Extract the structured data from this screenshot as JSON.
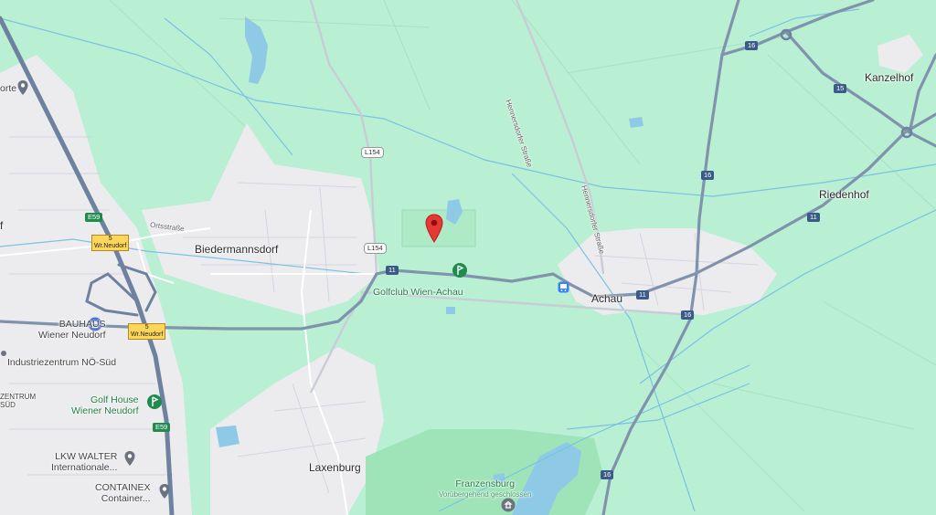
{
  "map": {
    "colors": {
      "land": "#b9efd2",
      "urban": "#ececef",
      "water": "#8ecae6",
      "motorway": "#7b8fa8",
      "park": "#9ee4b8",
      "marker": "#e53935"
    },
    "places": {
      "biedermannsdorf": "Biedermannsdorf",
      "achau": "Achau",
      "laxenburg": "Laxenburg",
      "kanzelhof": "Kanzelhof",
      "riedenhof": "Riedenhof"
    },
    "pois": {
      "golfclub": "Golfclub Wien-Achau",
      "bauhaus_1": "BAUHAUS",
      "bauhaus_2": "Wiener Neudorf",
      "industriezentrum": "Industriezentrum NÖ-Süd",
      "izentrum_cut_1": "ZENTRUM",
      "izentrum_cut_2": "SÜD",
      "golfhouse_1": "Golf House",
      "golfhouse_2": "Wiener Neudorf",
      "lkw_1": "LKW WALTER",
      "lkw_2": "Internationale...",
      "containex_1": "CONTAINEX",
      "containex_2": "Container...",
      "franzensburg_1": "Franzensburg",
      "franzensburg_2": "Vorübergehend geschlossen",
      "cut_orte": "orte",
      "cut_f": "f"
    },
    "streets": {
      "ortsstrasse": "Ortsstraße",
      "hennersdorfer_1": "Hennersdorfer Straße",
      "hennersdorfer_2": "Hennersdorfer Straße"
    },
    "shields": {
      "l154_a": "L154",
      "l154_b": "L154",
      "r11_a": "11",
      "r11_b": "11",
      "r11_c": "11",
      "r15": "15",
      "r16_a": "16",
      "r16_b": "16",
      "r16_c": "16",
      "r16_d": "16",
      "e59_a": "E59",
      "e59_b": "E59",
      "exit_a_num": "5",
      "exit_a_name": "Wr.Neudorf",
      "exit_b_num": "5",
      "exit_b_name": "Wr.Neudorf"
    }
  }
}
